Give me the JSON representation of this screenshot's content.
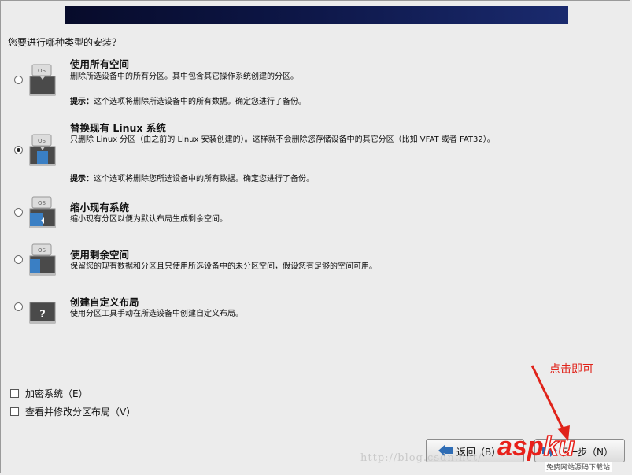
{
  "installer": {
    "question": "您要进行哪种类型的安装？",
    "options": [
      {
        "title": "使用所有空间",
        "description": "删除所选设备中的所有分区。其中包含其它操作系统创建的分区。",
        "tip_label": "提示：",
        "tip_text": "这个选项将删除所选设备中的所有数据。确定您进行了备份。",
        "selected": false,
        "icon": "disk-full-icon"
      },
      {
        "title": "替换现有 Linux 系统",
        "description": "只删除 Linux 分区（由之前的 Linux 安装创建的）。这样就不会删除您存储设备中的其它分区（比如 VFAT 或者 FAT32）。",
        "tip_label": "提示：",
        "tip_text": "这个选项将删除您所选设备中的所有数据。确定您进行了备份。",
        "selected": true,
        "icon": "disk-replace-icon"
      },
      {
        "title": "缩小现有系统",
        "description": "缩小现有分区以便为默认布局生成剩余空间。",
        "selected": false,
        "icon": "disk-shrink-icon"
      },
      {
        "title": "使用剩余空间",
        "description": "保留您的现有数据和分区且只使用所选设备中的未分区空间，假设您有足够的空间可用。",
        "selected": false,
        "icon": "disk-free-space-icon"
      },
      {
        "title": "创建自定义布局",
        "description": "使用分区工具手动在所选设备中创建自定义布局。",
        "selected": false,
        "icon": "disk-custom-icon"
      }
    ],
    "checkboxes": [
      {
        "label": "加密系统（E）",
        "checked": false
      },
      {
        "label": "查看并修改分区布局（V）",
        "checked": false
      }
    ],
    "buttons": {
      "back": "返回（B）",
      "next": "下一步（N）"
    },
    "disk_icon_label": "OS",
    "custom_icon_label": "?"
  },
  "annotation": "点击即可",
  "watermark": "http://blog.csdn.net/",
  "logo": {
    "asp": "asp",
    "ku": "ku",
    "sub": "免费网站源码下载站"
  },
  "colors": {
    "banner": "#0d1646",
    "annotation": "#e0231a",
    "disk_blue": "#3a7fc4"
  }
}
